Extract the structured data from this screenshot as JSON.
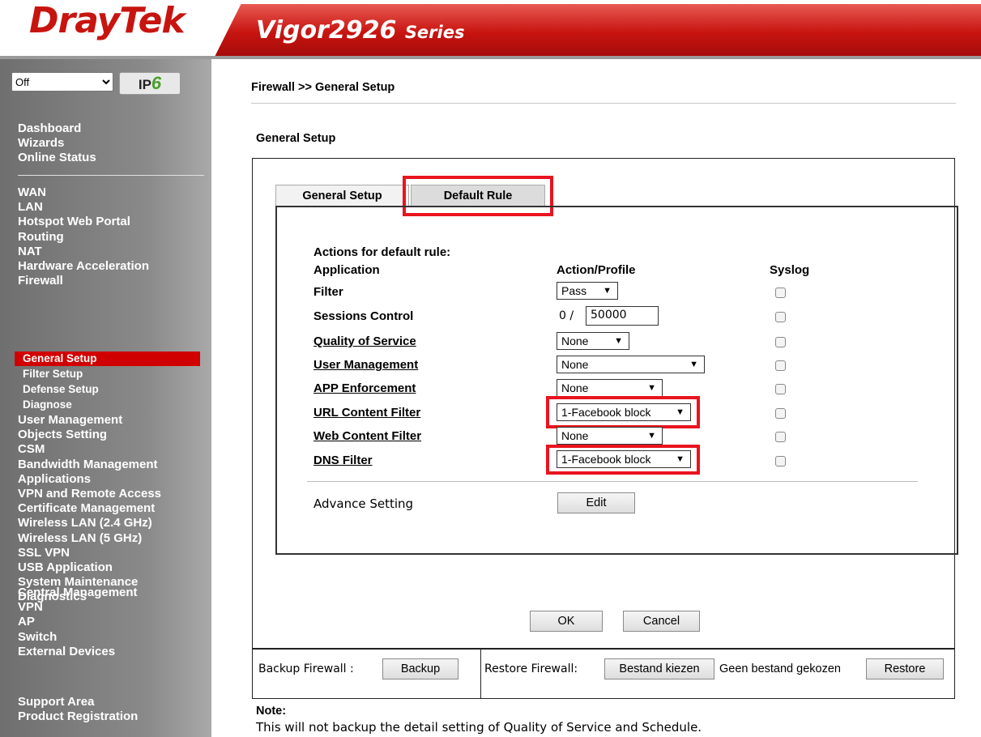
{
  "header": {
    "logo": "DrayTek",
    "model": "Vigor2926",
    "model_suffix": "Series"
  },
  "sidebar": {
    "mode_select": "Off",
    "ipv6_label": "IP",
    "ipv6_version": "6",
    "group1": [
      "Dashboard",
      "Wizards",
      "Online Status"
    ],
    "group2": [
      "WAN",
      "LAN",
      "Hotspot Web Portal",
      "Routing",
      "NAT",
      "Hardware Acceleration",
      "Firewall"
    ],
    "firewall_sub": [
      "General Setup",
      "Filter Setup",
      "Defense Setup",
      "Diagnose"
    ],
    "group3": [
      "User Management",
      "Objects Setting",
      "CSM",
      "Bandwidth Management",
      "Applications",
      "VPN and Remote Access",
      "Certificate Management",
      "Wireless LAN (2.4 GHz)",
      "Wireless LAN (5 GHz)",
      "SSL VPN",
      "USB Application",
      "System Maintenance",
      "Diagnostics"
    ],
    "group4": [
      "Central Management",
      "VPN",
      "AP",
      "Switch",
      "External Devices"
    ],
    "group5": [
      "Support Area",
      "Product Registration"
    ]
  },
  "main": {
    "breadcrumb": "Firewall >> General Setup",
    "section_title": "General Setup",
    "tabs": [
      "General Setup",
      "Default Rule"
    ],
    "actions_title": "Actions for default rule:",
    "col_application": "Application",
    "col_action": "Action/Profile",
    "col_syslog": "Syslog",
    "rows": [
      {
        "label": "Filter",
        "link": false,
        "value": "Pass"
      },
      {
        "label": "Sessions Control",
        "link": false,
        "value": "50000",
        "prefix": "0 /"
      },
      {
        "label": "Quality of Service",
        "link": true,
        "value": "None"
      },
      {
        "label": "User Management",
        "link": true,
        "value": "None"
      },
      {
        "label": "APP Enforcement",
        "link": true,
        "value": "None"
      },
      {
        "label": "URL Content Filter",
        "link": true,
        "value": "1-Facebook block"
      },
      {
        "label": "Web Content Filter",
        "link": true,
        "value": "None"
      },
      {
        "label": "DNS Filter",
        "link": true,
        "value": "1-Facebook block"
      }
    ],
    "advance_label": "Advance Setting",
    "edit_button": "Edit",
    "ok_button": "OK",
    "cancel_button": "Cancel",
    "backup_label": "Backup Firewall :",
    "backup_button": "Backup",
    "restore_label": "Restore Firewall:",
    "choose_file_button": "Bestand kiezen",
    "no_file_text": "Geen bestand gekozen",
    "restore_button": "Restore",
    "note_title": "Note:",
    "note_text": "This will not backup the detail setting of Quality of Service and Schedule."
  },
  "colors": {
    "brand_red": "#c8140f",
    "highlight": "#e8141e",
    "active_nav": "#d10000"
  }
}
